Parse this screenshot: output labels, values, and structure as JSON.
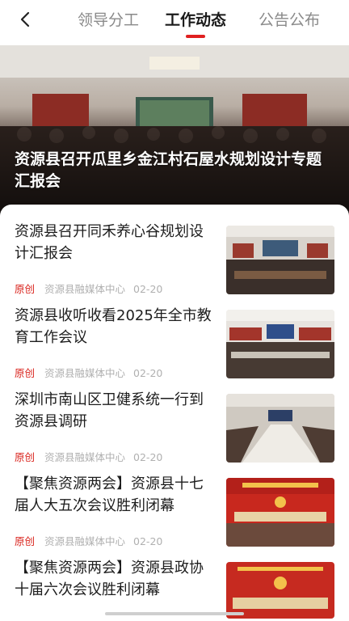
{
  "tabs": [
    {
      "label": "领导分工",
      "active": false
    },
    {
      "label": "工作动态",
      "active": true
    },
    {
      "label": "公告公布",
      "active": false
    }
  ],
  "hero": {
    "title": "资源县召开瓜里乡金江村石屋水规划设计专题汇报会"
  },
  "articles": [
    {
      "title": "资源县召开同禾养心谷规划设计汇报会",
      "tag": "原创",
      "source": "资源县融媒体中心",
      "date": "02-20"
    },
    {
      "title": "资源县收听收看2025年全市教育工作会议",
      "tag": "原创",
      "source": "资源县融媒体中心",
      "date": "02-20"
    },
    {
      "title": "深圳市南山区卫健系统一行到资源县调研",
      "tag": "原创",
      "source": "资源县融媒体中心",
      "date": "02-20"
    },
    {
      "title": "【聚焦资源两会】资源县十七届人大五次会议胜利闭幕",
      "tag": "原创",
      "source": "资源县融媒体中心",
      "date": "02-20"
    },
    {
      "title": "【聚焦资源两会】资源县政协十届六次会议胜利闭幕",
      "tag": "",
      "source": "",
      "date": ""
    }
  ],
  "colors": {
    "accent": "#e02020",
    "original_tag": "#d9231c"
  }
}
